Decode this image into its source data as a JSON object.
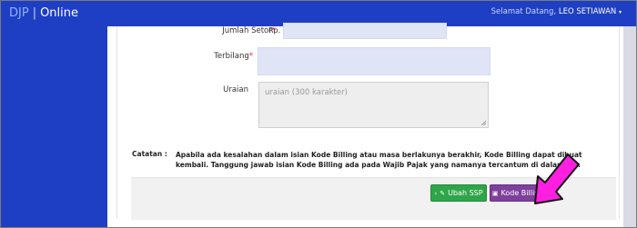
{
  "header": {
    "brand_djp": "DJP",
    "brand_sep": "|",
    "brand_online": "Online",
    "greeting": "Selamat Datang,",
    "user_name": "LEO SETIAWAN"
  },
  "form": {
    "jumlah_setor_label": "Jumlah Setor",
    "jumlah_setor_prefix": "Rp.",
    "terbilang_label": "Terbilang",
    "uraian_label": "Uraian",
    "uraian_placeholder": "uraian (300 karakter)",
    "required_mark": "*"
  },
  "note": {
    "label": "Catatan :",
    "text": "Apabila ada kesalahan dalam isian Kode Billing atau masa berlakunya berakhir, Kode Billing dapat dibuat kembali. Tanggung jawab isian Kode Billing ada pada Wajib Pajak yang namanya tercantum di dalamnya."
  },
  "buttons": {
    "ubah_ssp": "Ubah SSP",
    "kode_billing": "Kode Billing"
  },
  "colors": {
    "topbar": "#1e3fc4",
    "button_green": "#2fa54a",
    "button_purple": "#7f3f9c",
    "arrow_magenta": "#ff1fe0"
  }
}
